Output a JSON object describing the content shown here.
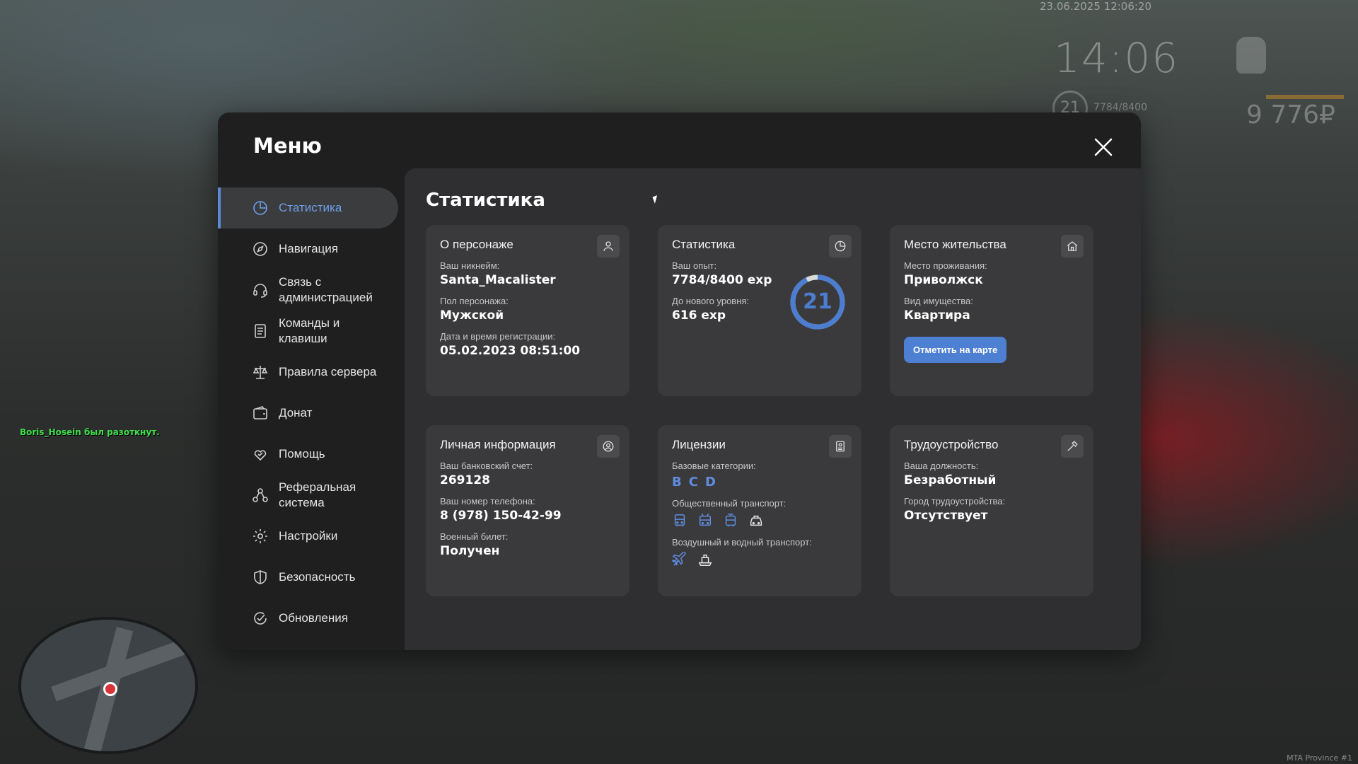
{
  "hud": {
    "datetime": "23.06.2025 12:06:20",
    "time": "14:06",
    "level": "21",
    "exp": "7784/8400",
    "money": "9 776₽",
    "watermark": "MTA Province #1"
  },
  "chat": {
    "line": "Boris_Hosein был разоткнут."
  },
  "modal": {
    "title": "Меню"
  },
  "sidebar": {
    "items": [
      {
        "label": "Статистика",
        "icon": "pie-chart-icon"
      },
      {
        "label": "Навигация",
        "icon": "compass-icon"
      },
      {
        "label": "Связь с администрацией",
        "icon": "headset-icon"
      },
      {
        "label": "Команды и клавиши",
        "icon": "document-icon"
      },
      {
        "label": "Правила сервера",
        "icon": "scales-icon"
      },
      {
        "label": "Донат",
        "icon": "wallet-icon"
      },
      {
        "label": "Помощь",
        "icon": "heart-hands-icon"
      },
      {
        "label": "Реферальная система",
        "icon": "network-icon"
      },
      {
        "label": "Настройки",
        "icon": "gear-icon"
      },
      {
        "label": "Безопасность",
        "icon": "shield-icon"
      },
      {
        "label": "Обновления",
        "icon": "check-circle-icon"
      }
    ],
    "active_index": 0
  },
  "content": {
    "title": "Статистика",
    "about": {
      "title": "О персонаже",
      "nick_label": "Ваш никнейм:",
      "nick": "Santa_Macalister",
      "gender_label": "Пол персонажа:",
      "gender": "Мужской",
      "reg_label": "Дата и время регистрации:",
      "reg": "05.02.2023 08:51:00"
    },
    "stats": {
      "title": "Статистика",
      "exp_label": "Ваш опыт:",
      "exp": "7784/8400 exp",
      "next_label": "До нового уровня:",
      "next": "616 exp",
      "level": "21",
      "progress": 0.927
    },
    "residence": {
      "title": "Место жительства",
      "place_label": "Место проживания:",
      "place": "Приволжск",
      "property_label": "Вид имущества:",
      "property": "Квартира",
      "button": "Отметить на карте"
    },
    "personal": {
      "title": "Личная информация",
      "bank_label": "Ваш банковский счет:",
      "bank": "269128",
      "phone_label": "Ваш номер телефона:",
      "phone": "8 (978) 150-42-99",
      "military_label": "Военный билет:",
      "military": "Получен"
    },
    "licenses": {
      "title": "Лицензии",
      "base_label": "Базовые категории:",
      "categories": [
        "B",
        "C",
        "D"
      ],
      "public_label": "Общественный транспорт:",
      "public_icons": [
        "bus-icon",
        "trolleybus-icon",
        "tram-icon",
        "taxi-icon"
      ],
      "air_label": "Воздушный и водный транспорт:",
      "air_icons": [
        "airplane-icon",
        "boat-icon"
      ]
    },
    "job": {
      "title": "Трудоустройство",
      "position_label": "Ваша должность:",
      "position": "Безработный",
      "city_label": "Город трудоустройства:",
      "city": "Отсутствует"
    }
  },
  "colors": {
    "accent": "#5c89d6",
    "modal_bg": "#1f1f20",
    "content_bg": "#2f2f31",
    "card_bg": "#3a3a3c"
  }
}
